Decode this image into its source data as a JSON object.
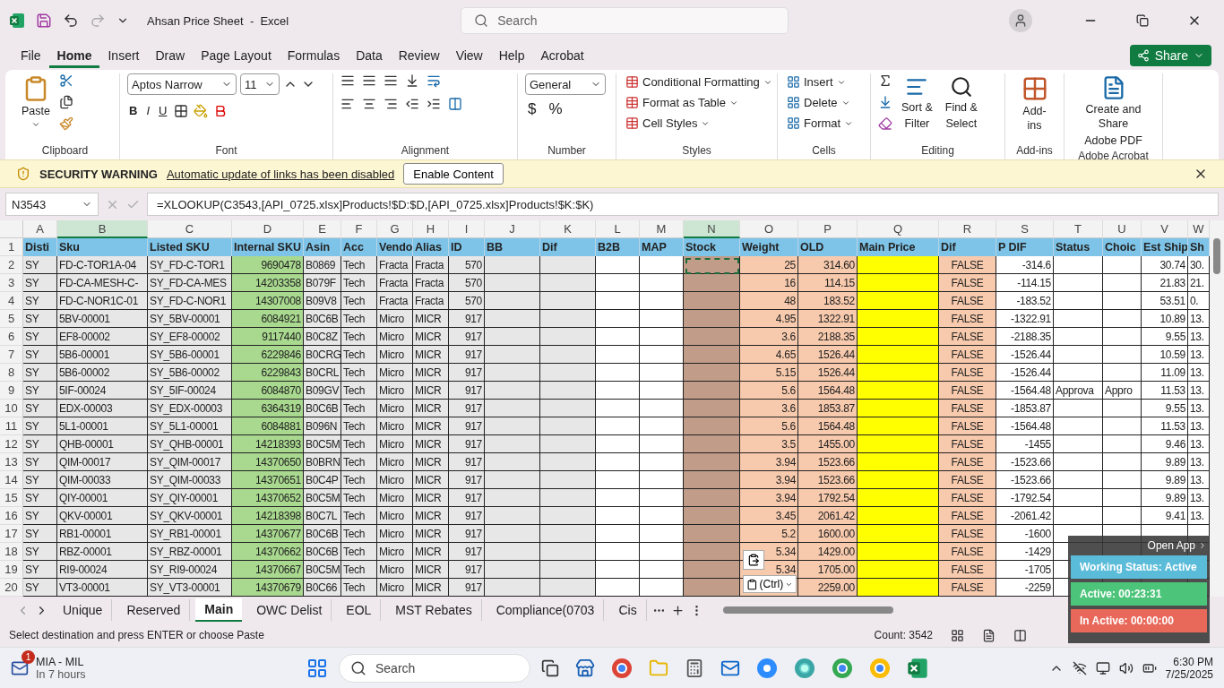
{
  "window": {
    "title": "Ahsan Price Sheet  -  Excel",
    "search_placeholder": "Search"
  },
  "share": {
    "label": "Share"
  },
  "menu_tabs": [
    {
      "label": "File",
      "selected": false
    },
    {
      "label": "Home",
      "selected": true
    },
    {
      "label": "Insert",
      "selected": false
    },
    {
      "label": "Draw",
      "selected": false
    },
    {
      "label": "Page Layout",
      "selected": false
    },
    {
      "label": "Formulas",
      "selected": false
    },
    {
      "label": "Data",
      "selected": false
    },
    {
      "label": "Review",
      "selected": false
    },
    {
      "label": "View",
      "selected": false
    },
    {
      "label": "Help",
      "selected": false
    },
    {
      "label": "Acrobat",
      "selected": false
    }
  ],
  "ribbon": {
    "clipboard": {
      "label": "Clipboard",
      "paste": "Paste"
    },
    "font": {
      "label": "Font",
      "family": "Aptos Narrow",
      "size": "11",
      "bold": "B",
      "italic": "I",
      "underline": "U"
    },
    "alignment": {
      "label": "Alignment"
    },
    "number": {
      "label": "Number",
      "format": "General",
      "currency": "$",
      "percent": "%"
    },
    "styles": {
      "label": "Styles",
      "items": [
        "Conditional Formatting",
        "Format as Table",
        "Cell Styles"
      ]
    },
    "cells": {
      "label": "Cells",
      "items": [
        "Insert",
        "Delete",
        "Format"
      ]
    },
    "editing": {
      "label": "Editing",
      "sort": [
        "Sort &",
        "Filter"
      ],
      "find": [
        "Find &",
        "Select"
      ]
    },
    "addins": {
      "label": "Add-ins",
      "button": "Add-ins"
    },
    "acrobat": {
      "label": "Adobe Acrobat",
      "button": [
        "Create and Share",
        "Adobe PDF"
      ]
    }
  },
  "security_bar": {
    "title": "SECURITY WARNING",
    "message": "Automatic update of links has been disabled",
    "button": "Enable Content"
  },
  "formula_bar": {
    "name_box": "N3543",
    "formula": "=XLOOKUP(C3543,[API_0725.xlsx]Products!$D:$D,[API_0725.xlsx]Products!$K:$K)"
  },
  "columns": [
    {
      "letter": "A",
      "header": "Disti",
      "kind": "text",
      "color": "#e7e7e7",
      "selected": false
    },
    {
      "letter": "B",
      "header": "Sku",
      "kind": "text",
      "color": "#e7e7e7",
      "selected": true
    },
    {
      "letter": "C",
      "header": "Listed SKU",
      "kind": "text",
      "color": "#e7e7e7",
      "selected": false
    },
    {
      "letter": "D",
      "header": "Internal SKU",
      "kind": "number",
      "color": "#a9d98f",
      "selected": false
    },
    {
      "letter": "E",
      "header": "Asin",
      "kind": "text",
      "color": "#e7e7e7",
      "selected": false
    },
    {
      "letter": "F",
      "header": "Acc",
      "kind": "text",
      "color": "#e7e7e7",
      "selected": false
    },
    {
      "letter": "G",
      "header": "Vendo",
      "kind": "text",
      "color": "#e7e7e7",
      "selected": false
    },
    {
      "letter": "H",
      "header": "Alias",
      "kind": "text",
      "color": "#e7e7e7",
      "selected": false
    },
    {
      "letter": "I",
      "header": "ID",
      "kind": "number",
      "color": "#e7e7e7",
      "selected": false
    },
    {
      "letter": "J",
      "header": "BB",
      "kind": "text",
      "color": "#e7e7e7",
      "selected": false
    },
    {
      "letter": "K",
      "header": "Dif",
      "kind": "text",
      "color": "#e7e7e7",
      "selected": false
    },
    {
      "letter": "L",
      "header": "B2B",
      "kind": "text",
      "color": "#ffffff",
      "selected": false
    },
    {
      "letter": "M",
      "header": "MAP",
      "kind": "text",
      "color": "#ffffff",
      "selected": false
    },
    {
      "letter": "N",
      "header": "Stock",
      "kind": "text",
      "color": "#c09c89",
      "selected": true
    },
    {
      "letter": "O",
      "header": "Weight",
      "kind": "number",
      "color": "#f8caad",
      "selected": false
    },
    {
      "letter": "P",
      "header": "OLD",
      "kind": "number",
      "color": "#f8caad",
      "selected": false
    },
    {
      "letter": "Q",
      "header": "Main Price",
      "kind": "text",
      "color": "#ffff00",
      "selected": false
    },
    {
      "letter": "R",
      "header": "Dif",
      "kind": "bool",
      "color": "#f8caad",
      "selected": false
    },
    {
      "letter": "S",
      "header": "P DIF",
      "kind": "number",
      "color": "#ffffff",
      "selected": false
    },
    {
      "letter": "T",
      "header": "Status",
      "kind": "text",
      "color": "#ffffff",
      "selected": false
    },
    {
      "letter": "U",
      "header": "Choic",
      "kind": "text",
      "color": "#ffffff",
      "selected": false
    },
    {
      "letter": "V",
      "header": "Est Ship",
      "kind": "number",
      "color": "#ffffff",
      "selected": false
    },
    {
      "letter": "W",
      "header": "Sh",
      "kind": "text",
      "color": "#ffffff",
      "selected": false
    }
  ],
  "header_row_number": "1",
  "rows": [
    {
      "number": "2",
      "cells": [
        "SY",
        "FD-C-TOR1A-04",
        "SY_FD-C-TOR1",
        "9690478",
        "B0869",
        "Tech",
        "Fracta",
        "Fracta",
        "570",
        "",
        "",
        "",
        "",
        "",
        "25",
        "314.60",
        "",
        "FALSE",
        "-314.6",
        "",
        "",
        "30.74",
        "30."
      ]
    },
    {
      "number": "3",
      "cells": [
        "SY",
        "FD-CA-MESH-C-",
        "SY_FD-CA-MES",
        "14203358",
        "B079F",
        "Tech",
        "Fracta",
        "Fracta",
        "570",
        "",
        "",
        "",
        "",
        "",
        "16",
        "114.15",
        "",
        "FALSE",
        "-114.15",
        "",
        "",
        "21.83",
        "21."
      ]
    },
    {
      "number": "4",
      "cells": [
        "SY",
        "FD-C-NOR1C-01",
        "SY_FD-C-NOR1",
        "14307008",
        "B09V8",
        "Tech",
        "Fracta",
        "Fracta",
        "570",
        "",
        "",
        "",
        "",
        "",
        "48",
        "183.52",
        "",
        "FALSE",
        "-183.52",
        "",
        "",
        "53.51",
        "0."
      ]
    },
    {
      "number": "5",
      "cells": [
        "SY",
        "5BV-00001",
        "SY_5BV-00001",
        "6084921",
        "B0C6B",
        "Tech",
        "Micro",
        "MICR",
        "917",
        "",
        "",
        "",
        "",
        "",
        "4.95",
        "1322.91",
        "",
        "FALSE",
        "-1322.91",
        "",
        "",
        "10.89",
        "13."
      ]
    },
    {
      "number": "6",
      "cells": [
        "SY",
        "EF8-00002",
        "SY_EF8-00002",
        "9117440",
        "B0C8Z",
        "Tech",
        "Micro",
        "MICR",
        "917",
        "",
        "",
        "",
        "",
        "",
        "3.6",
        "2188.35",
        "",
        "FALSE",
        "-2188.35",
        "",
        "",
        "9.55",
        "13."
      ]
    },
    {
      "number": "7",
      "cells": [
        "SY",
        "5B6-00001",
        "SY_5B6-00001",
        "6229846",
        "B0CRG",
        "Tech",
        "Micro",
        "MICR",
        "917",
        "",
        "",
        "",
        "",
        "",
        "4.65",
        "1526.44",
        "",
        "FALSE",
        "-1526.44",
        "",
        "",
        "10.59",
        "13."
      ]
    },
    {
      "number": "8",
      "cells": [
        "SY",
        "5B6-00002",
        "SY_5B6-00002",
        "6229843",
        "B0CRL",
        "Tech",
        "Micro",
        "MICR",
        "917",
        "",
        "",
        "",
        "",
        "",
        "5.15",
        "1526.44",
        "",
        "FALSE",
        "-1526.44",
        "",
        "",
        "11.09",
        "13."
      ]
    },
    {
      "number": "9",
      "cells": [
        "SY",
        "5IF-00024",
        "SY_5IF-00024",
        "6084870",
        "B09GV",
        "Tech",
        "Micro",
        "MICR",
        "917",
        "",
        "",
        "",
        "",
        "",
        "5.6",
        "1564.48",
        "",
        "FALSE",
        "-1564.48",
        "Approva",
        "Appro",
        "11.53",
        "13."
      ]
    },
    {
      "number": "10",
      "cells": [
        "SY",
        "EDX-00003",
        "SY_EDX-00003",
        "6364319",
        "B0C6B",
        "Tech",
        "Micro",
        "MICR",
        "917",
        "",
        "",
        "",
        "",
        "",
        "3.6",
        "1853.87",
        "",
        "FALSE",
        "-1853.87",
        "",
        "",
        "9.55",
        "13."
      ]
    },
    {
      "number": "11",
      "cells": [
        "SY",
        "5L1-00001",
        "SY_5L1-00001",
        "6084881",
        "B096N",
        "Tech",
        "Micro",
        "MICR",
        "917",
        "",
        "",
        "",
        "",
        "",
        "5.6",
        "1564.48",
        "",
        "FALSE",
        "-1564.48",
        "",
        "",
        "11.53",
        "13."
      ]
    },
    {
      "number": "12",
      "cells": [
        "SY",
        "QHB-00001",
        "SY_QHB-00001",
        "14218393",
        "B0C5M",
        "Tech",
        "Micro",
        "MICR",
        "917",
        "",
        "",
        "",
        "",
        "",
        "3.5",
        "1455.00",
        "",
        "FALSE",
        "-1455",
        "",
        "",
        "9.46",
        "13."
      ]
    },
    {
      "number": "13",
      "cells": [
        "SY",
        "QIM-00017",
        "SY_QIM-00017",
        "14370650",
        "B0BRN",
        "Tech",
        "Micro",
        "MICR",
        "917",
        "",
        "",
        "",
        "",
        "",
        "3.94",
        "1523.66",
        "",
        "FALSE",
        "-1523.66",
        "",
        "",
        "9.89",
        "13."
      ]
    },
    {
      "number": "14",
      "cells": [
        "SY",
        "QIM-00033",
        "SY_QIM-00033",
        "14370651",
        "B0C4P",
        "Tech",
        "Micro",
        "MICR",
        "917",
        "",
        "",
        "",
        "",
        "",
        "3.94",
        "1523.66",
        "",
        "FALSE",
        "-1523.66",
        "",
        "",
        "9.89",
        "13."
      ]
    },
    {
      "number": "15",
      "cells": [
        "SY",
        "QIY-00001",
        "SY_QIY-00001",
        "14370652",
        "B0C5M",
        "Tech",
        "Micro",
        "MICR",
        "917",
        "",
        "",
        "",
        "",
        "",
        "3.94",
        "1792.54",
        "",
        "FALSE",
        "-1792.54",
        "",
        "",
        "9.89",
        "13."
      ]
    },
    {
      "number": "16",
      "cells": [
        "SY",
        "QKV-00001",
        "SY_QKV-00001",
        "14218398",
        "B0C7L",
        "Tech",
        "Micro",
        "MICR",
        "917",
        "",
        "",
        "",
        "",
        "",
        "3.45",
        "2061.42",
        "",
        "FALSE",
        "-2061.42",
        "",
        "",
        "9.41",
        "13."
      ]
    },
    {
      "number": "17",
      "cells": [
        "SY",
        "RB1-00001",
        "SY_RB1-00001",
        "14370677",
        "B0C6B",
        "Tech",
        "Micro",
        "MICR",
        "917",
        "",
        "",
        "",
        "",
        "",
        "5.2",
        "1600.00",
        "",
        "FALSE",
        "-1600",
        "",
        "",
        "",
        ""
      ]
    },
    {
      "number": "18",
      "cells": [
        "SY",
        "RBZ-00001",
        "SY_RBZ-00001",
        "14370662",
        "B0C6B",
        "Tech",
        "Micro",
        "MICR",
        "917",
        "",
        "",
        "",
        "",
        "",
        "5.34",
        "1429.00",
        "",
        "FALSE",
        "-1429",
        "",
        "",
        "",
        ""
      ]
    },
    {
      "number": "19",
      "cells": [
        "SY",
        "RI9-00024",
        "SY_RI9-00024",
        "14370667",
        "B0C5M",
        "Tech",
        "Micro",
        "MICR",
        "917",
        "",
        "",
        "",
        "",
        "",
        "5.34",
        "1705.00",
        "",
        "FALSE",
        "-1705",
        "",
        "",
        "",
        ""
      ]
    },
    {
      "number": "20",
      "cells": [
        "SY",
        "VT3-00001",
        "SY_VT3-00001",
        "14370679",
        "B0C66",
        "Tech",
        "Micro",
        "MICR",
        "917",
        "",
        "",
        "",
        "",
        "",
        "",
        "2259.00",
        "",
        "FALSE",
        "-2259",
        "",
        "",
        "",
        ""
      ]
    }
  ],
  "paste_options": {
    "label": "(Ctrl)"
  },
  "sheet_tabs": [
    {
      "label": "Unique",
      "selected": false
    },
    {
      "label": "Reserved",
      "selected": false
    },
    {
      "label": "Main",
      "selected": true
    },
    {
      "label": "OWC Delist",
      "selected": false
    },
    {
      "label": "EOL",
      "selected": false
    },
    {
      "label": "MST Rebates",
      "selected": false
    },
    {
      "label": "Compliance(0703",
      "selected": false
    },
    {
      "label": "Cis",
      "selected": false
    }
  ],
  "status_bar": {
    "message": "Select destination and press ENTER or choose Paste",
    "count": "Count: 3542"
  },
  "tracker": {
    "open_app": "Open App",
    "status": "Working Status: Active",
    "active": "Active: 00:23:31",
    "inactive": "In Active: 00:00:00"
  },
  "taskbar": {
    "weather_title": "MIA - MIL",
    "weather_sub": "In 7 hours",
    "badge": "1",
    "search": "Search",
    "time": "6:30 PM",
    "date": "7/25/2025"
  }
}
